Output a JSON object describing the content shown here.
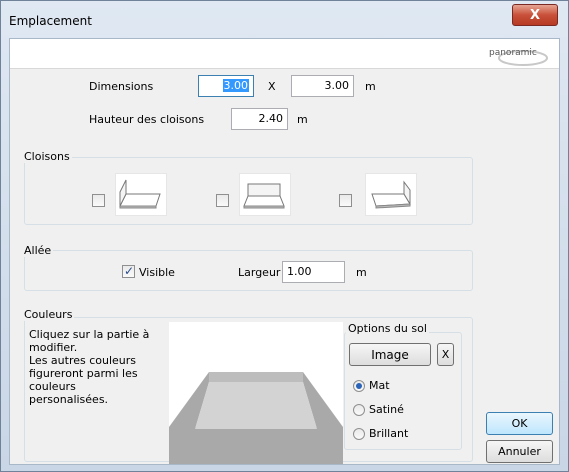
{
  "window": {
    "title": "Emplacement",
    "close_glyph": "X"
  },
  "banner": {
    "logo_text": "panoramic"
  },
  "dimensions": {
    "label": "Dimensions",
    "width_value": "3.00",
    "separator": "X",
    "depth_value": "3.00",
    "unit": "m"
  },
  "hauteur": {
    "label": "Hauteur des cloisons",
    "value": "2.40",
    "unit": "m"
  },
  "cloisons": {
    "label": "Cloisons",
    "options": [
      {
        "checked": false,
        "thumb_icon": "wall-left-back-icon"
      },
      {
        "checked": false,
        "thumb_icon": "wall-back-icon"
      },
      {
        "checked": false,
        "thumb_icon": "wall-right-back-icon"
      }
    ]
  },
  "allee": {
    "label": "Allée",
    "visible_label": "Visible",
    "visible_checked": true,
    "largeur_label": "Largeur",
    "largeur_value": "1.00",
    "unit": "m"
  },
  "couleurs": {
    "label": "Couleurs",
    "description": "Cliquez sur la partie à\nmodifier.\nLes autres couleurs\nfigureront parmi les\ncouleurs\npersonalisées."
  },
  "options_sol": {
    "label": "Options du sol",
    "image_button": "Image",
    "clear_button": "X",
    "finishes": [
      {
        "label": "Mat",
        "selected": true
      },
      {
        "label": "Satiné",
        "selected": false
      },
      {
        "label": "Brillant",
        "selected": false
      }
    ]
  },
  "actions": {
    "ok": "OK",
    "cancel": "Annuler"
  },
  "colors": {
    "selection": "#3399ff",
    "floor_light": "#d3d3d3",
    "floor_dark": "#a9a9a9"
  }
}
